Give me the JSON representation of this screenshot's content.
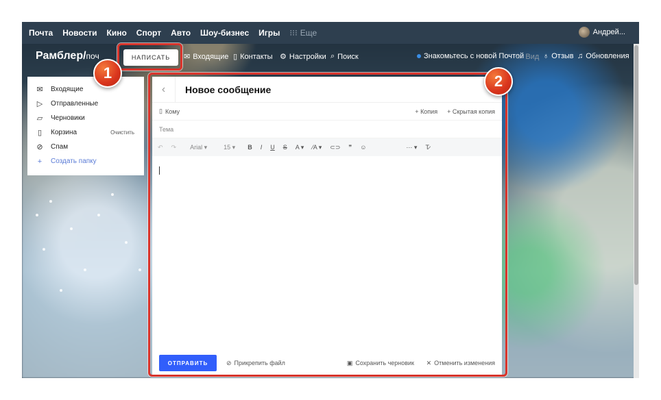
{
  "topnav": {
    "links": [
      "Почта",
      "Новости",
      "Кино",
      "Спорт",
      "Авто",
      "Шоу-бизнес",
      "Игры"
    ],
    "more": "Еще",
    "user": "Андрей..."
  },
  "secnav": {
    "logo": "Рамблер/",
    "logo_suffix": "поч",
    "write_button": "НАПИСАТЬ",
    "inbox": "Входящие",
    "contacts": "Контакты",
    "settings": "Настройки",
    "search": "Поиск",
    "promo": "Знакомьтесь с новой Почтой",
    "view": "Вид",
    "feedback": "Отзыв",
    "updates": "Обновления"
  },
  "sidebar": {
    "items": [
      {
        "label": "Входящие",
        "icon": "inbox-icon"
      },
      {
        "label": "Отправленные",
        "icon": "send-icon"
      },
      {
        "label": "Черновики",
        "icon": "draft-icon"
      },
      {
        "label": "Корзина",
        "icon": "trash-icon",
        "action": "Очистить"
      },
      {
        "label": "Спам",
        "icon": "spam-icon"
      }
    ],
    "create_folder": "Создать папку"
  },
  "compose": {
    "title": "Новое сообщение",
    "to_label": "Кому",
    "cc": "Копия",
    "bcc": "Скрытая копия",
    "subject_placeholder": "Тема",
    "font": "Arial",
    "font_size": "15",
    "send": "ОТПРАВИТЬ",
    "attach": "Прикрепить файл",
    "save_draft": "Сохранить черновик",
    "cancel": "Отменить изменения"
  },
  "annotations": {
    "step1": "1",
    "step2": "2",
    "color": "#d9342b"
  }
}
